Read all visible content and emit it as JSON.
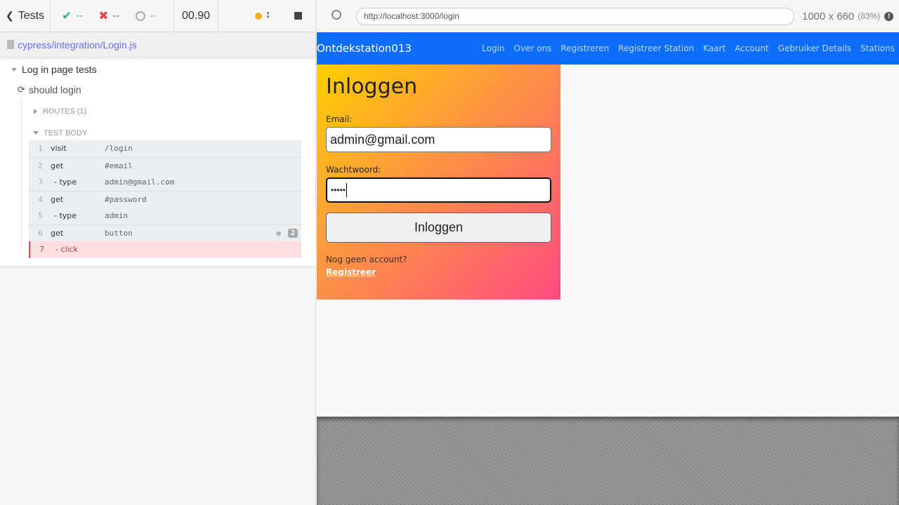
{
  "reporter": {
    "back_label": "Tests",
    "passed": "--",
    "failed": "--",
    "pending": "--",
    "duration": "00.90",
    "spec_file": "cypress/integration/Login.js",
    "suite": "Log in page tests",
    "test": "should login",
    "routes": "ROUTES (1)",
    "test_body": "TEST BODY",
    "commands": [
      {
        "n": "1",
        "name": "visit",
        "msg": "/login"
      },
      {
        "n": "2",
        "name": "get",
        "msg": "#email"
      },
      {
        "n": "3",
        "name": "- type",
        "msg": "admin@gmail.com"
      },
      {
        "n": "4",
        "name": "get",
        "msg": "#password"
      },
      {
        "n": "5",
        "name": "- type",
        "msg": "admin"
      },
      {
        "n": "6",
        "name": "get",
        "msg": "button",
        "badge": "2"
      },
      {
        "n": "7",
        "name": "- click",
        "msg": ""
      }
    ]
  },
  "browser": {
    "url": "http://localhost:3000/login",
    "viewport": "1000 x 660",
    "scale": "(83%)"
  },
  "app": {
    "brand": "Ontdekstation013",
    "nav": [
      "Login",
      "Over ons",
      "Registreren",
      "Registreer Station",
      "Kaart",
      "Account",
      "Gebruiker Details",
      "Stations"
    ],
    "title": "Inloggen",
    "email_label": "Email:",
    "email_value": "admin@gmail.com",
    "password_label": "Wachtwoord:",
    "password_value": "•••••",
    "submit": "Inloggen",
    "no_account": "Nog geen account?",
    "register_link": "Registreer"
  }
}
